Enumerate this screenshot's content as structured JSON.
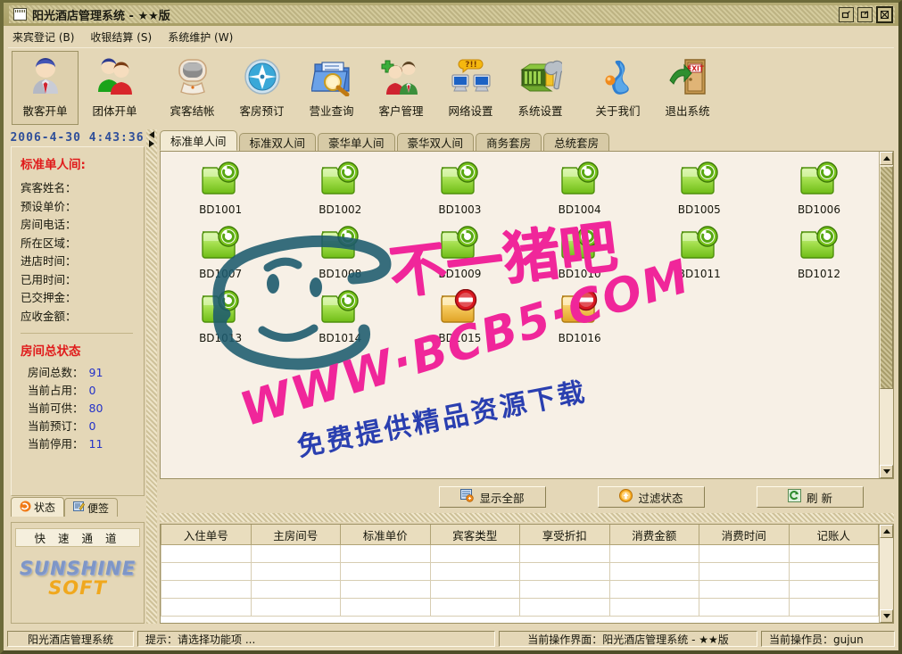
{
  "window": {
    "title": "阳光酒店管理系统 - ★★版",
    "sysicon": "window-icon",
    "buttons": [
      {
        "name": "restore-button",
        "label": "❐"
      },
      {
        "name": "maximize-button",
        "label": "❒"
      },
      {
        "name": "close-button",
        "label": "⊠"
      }
    ]
  },
  "menubar": {
    "items": [
      {
        "label": "来宾登记 (B)"
      },
      {
        "label": "收银结算 (S)"
      },
      {
        "label": "系统维护 (W)"
      }
    ]
  },
  "toolbar": {
    "buttons": [
      {
        "label": "散客开单",
        "icon": "single-guest-icon",
        "selected": true
      },
      {
        "label": "团体开单",
        "icon": "group-guest-icon",
        "selected": false
      },
      {
        "label": "宾客结帐",
        "icon": "checkout-monitor-icon",
        "selected": false
      },
      {
        "label": "客房预订",
        "icon": "compass-icon",
        "selected": false
      },
      {
        "label": "营业查询",
        "icon": "folder-search-icon",
        "selected": false
      },
      {
        "label": "客户管理",
        "icon": "customers-icon",
        "selected": false
      },
      {
        "label": "网络设置",
        "icon": "network-icon",
        "selected": false
      },
      {
        "label": "系统设置",
        "icon": "wrench-settings-icon",
        "selected": false
      },
      {
        "label": "关于我们",
        "icon": "about-icon",
        "selected": false
      },
      {
        "label": "退出系统",
        "icon": "exit-door-icon",
        "selected": false
      }
    ]
  },
  "sidebar": {
    "clock": "2006-4-30  4:43:36",
    "room_title": "标准单人间:",
    "fields": [
      "宾客姓名：",
      "预设单价：",
      "房间电话：",
      "所在区域：",
      "进店时间：",
      "已用时间：",
      "已交押金：",
      "应收金额："
    ],
    "stats_title": "房间总状态",
    "stats": [
      {
        "label": "房间总数：",
        "value": "91"
      },
      {
        "label": "当前占用：",
        "value": "0"
      },
      {
        "label": "当前可供：",
        "value": "80"
      },
      {
        "label": "当前预订：",
        "value": "0"
      },
      {
        "label": "当前停用：",
        "value": "11"
      }
    ],
    "tabs": [
      {
        "label": "状态",
        "icon": "status-swirl-icon",
        "active": true
      },
      {
        "label": "便签",
        "icon": "notepad-icon",
        "active": false
      }
    ],
    "quick_title": "快 速 通 道",
    "logo_line1": "SUNSHINE",
    "logo_line2": "SOFT"
  },
  "main": {
    "tabs": [
      {
        "label": "标准单人间",
        "active": true
      },
      {
        "label": "标准双人间",
        "active": false
      },
      {
        "label": "豪华单人间",
        "active": false
      },
      {
        "label": "豪华双人间",
        "active": false
      },
      {
        "label": "商务套房",
        "active": false
      },
      {
        "label": "总统套房",
        "active": false
      }
    ],
    "rooms": [
      {
        "id": "BD1001",
        "state": "available"
      },
      {
        "id": "BD1002",
        "state": "available"
      },
      {
        "id": "BD1003",
        "state": "available"
      },
      {
        "id": "BD1004",
        "state": "available"
      },
      {
        "id": "BD1005",
        "state": "available"
      },
      {
        "id": "BD1006",
        "state": "available"
      },
      {
        "id": "BD1007",
        "state": "available"
      },
      {
        "id": "BD1008",
        "state": "available"
      },
      {
        "id": "BD1009",
        "state": "available"
      },
      {
        "id": "BD1010",
        "state": "available"
      },
      {
        "id": "BD1011",
        "state": "available"
      },
      {
        "id": "BD1012",
        "state": "available"
      },
      {
        "id": "BD1013",
        "state": "available"
      },
      {
        "id": "BD1014",
        "state": "available"
      },
      {
        "id": "BD1015",
        "state": "disabled"
      },
      {
        "id": "BD1016",
        "state": "disabled"
      }
    ],
    "actions": [
      {
        "label": "显示全部",
        "icon": "show-all-icon"
      },
      {
        "label": "过滤状态",
        "icon": "filter-icon"
      },
      {
        "label": "刷 新",
        "icon": "refresh-icon"
      }
    ]
  },
  "table": {
    "headers": [
      "入住单号",
      "主房间号",
      "标准单价",
      "宾客类型",
      "享受折扣",
      "消费金额",
      "消费时间",
      "记账人"
    ],
    "rows": [
      [
        "",
        "",
        "",
        "",
        "",
        "",
        "",
        ""
      ],
      [
        "",
        "",
        "",
        "",
        "",
        "",
        "",
        ""
      ],
      [
        "",
        "",
        "",
        "",
        "",
        "",
        "",
        ""
      ],
      [
        "",
        "",
        "",
        "",
        "",
        "",
        "",
        ""
      ]
    ]
  },
  "statusbar": {
    "app_name": "阳光酒店管理系统",
    "hint": "提示：请选择功能项 ...",
    "current_ui": "当前操作界面：阳光酒店管理系统 - ★★版",
    "operator": "当前操作员：gujun"
  },
  "watermark": {
    "cn_text": "不一猪吧",
    "url_text": "WWW·BCB5·COM",
    "sub_text": "免费提供精品资源下载"
  },
  "colors": {
    "frame": "#e4d7b7",
    "content": "#f7f0e6",
    "accent_red": "#e01b1b",
    "accent_blue": "#2432c8",
    "title_blue": "#2f4f9a",
    "watermark_pink": "#f0269a",
    "watermark_blue": "#2a3fb0",
    "watermark_teal": "#1d5b6e"
  }
}
